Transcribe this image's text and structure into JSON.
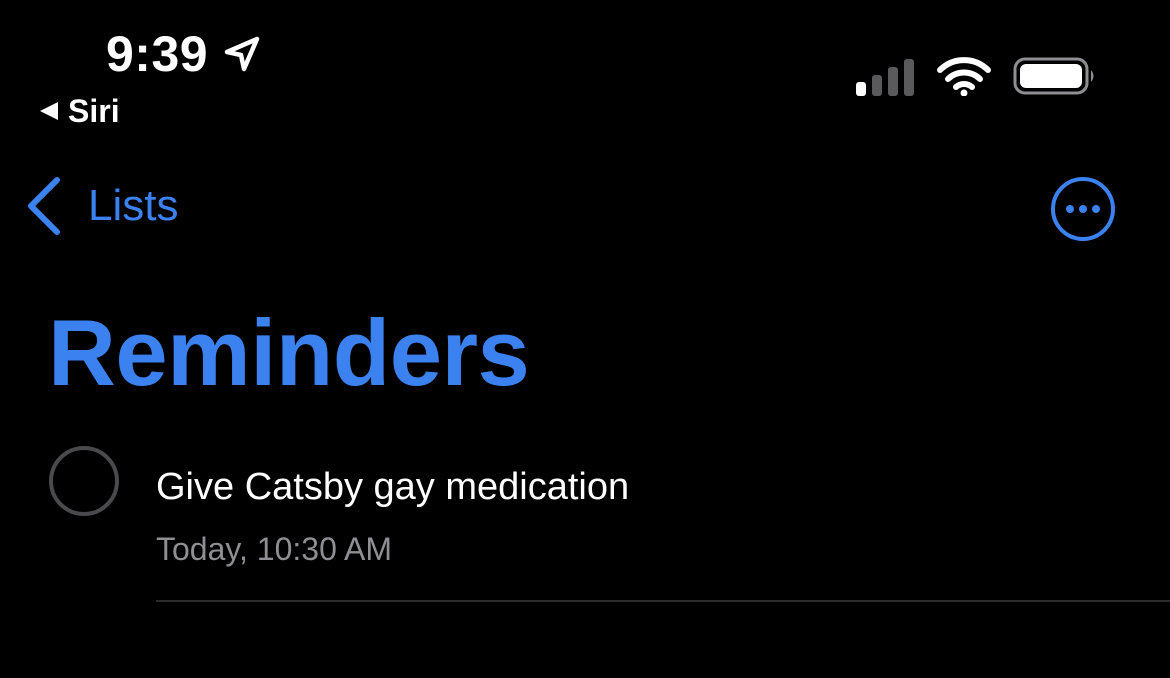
{
  "status_bar": {
    "time": "9:39",
    "back_app_label": "Siri",
    "icons": [
      "location-arrow-icon",
      "back-triangle-icon",
      "cellular-signal-icon",
      "wifi-icon",
      "battery-icon"
    ]
  },
  "nav": {
    "back_label": "Lists",
    "more_icon": "ellipsis-circle-icon"
  },
  "title": "Reminders",
  "reminders": [
    {
      "title": "Give Catsby gay medication",
      "due": "Today, 10:30 AM",
      "completed": false
    }
  ],
  "colors": {
    "background": "#000000",
    "accent": "#3b82f0",
    "primary_text": "#ffffff",
    "secondary_text": "#8e8e93",
    "checkbox_border": "#4a4a4c",
    "divider": "#2c2c2e"
  }
}
